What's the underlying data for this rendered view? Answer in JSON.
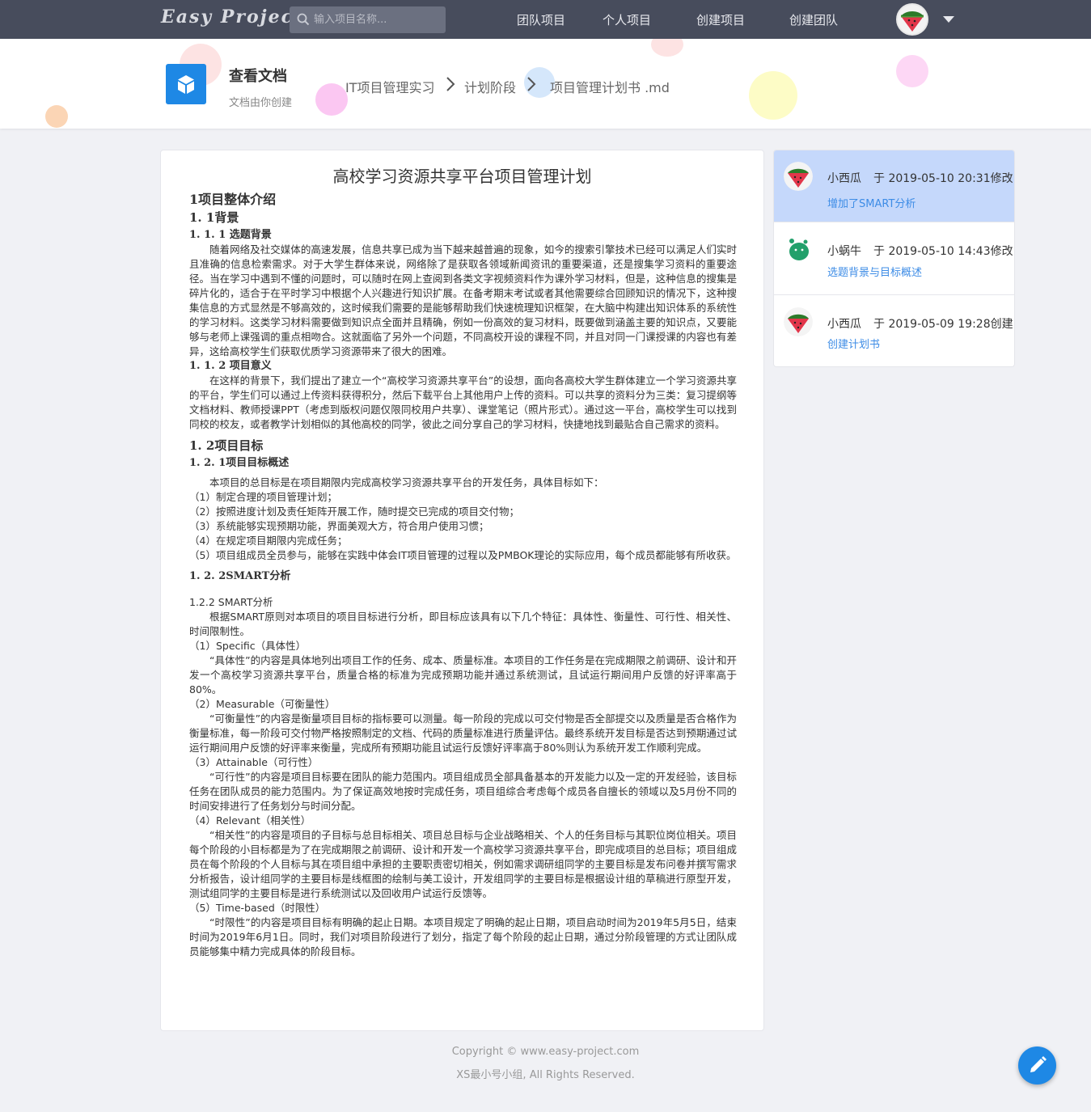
{
  "nav": {
    "logo": "Easy Project",
    "search_placeholder": "输入项目名称...",
    "links": [
      "团队项目",
      "个人项目",
      "创建项目",
      "创建团队"
    ]
  },
  "header": {
    "title": "查看文档",
    "subtitle": "文档由你创建",
    "breadcrumb": [
      "IT项目管理实习",
      "计划阶段",
      "项目管理计划书 .md"
    ]
  },
  "document": {
    "title": "高校学习资源共享平台项目管理计划",
    "h_1": "1项目整体介绍",
    "h_1_1": "1. 1背景",
    "h_1_1_1": "1. 1. 1  选题背景",
    "p_background": "随着网络及社交媒体的高速发展，信息共享已成为当下越来越普遍的现象，如今的搜索引擎技术已经可以满足人们实时且准确的信息检索需求。对于大学生群体来说，网络除了是获取各领域新闻资讯的重要渠道，还是搜集学习资料的重要途径。当在学习中遇到不懂的问题时，可以随时在网上查阅到各类文字视频资料作为课外学习材料，但是，这种信息的搜集是碎片化的，适合于在平时学习中根据个人兴趣进行知识扩展。在备考期末考试或者其他需要综合回顾知识的情况下，这种搜集信息的方式显然是不够高效的，这时候我们需要的是能够帮助我们快速梳理知识框架，在大脑中构建出知识体系的系统性的学习材料。这类学习材料需要做到知识点全面并且精确，例如一份高效的复习材料，既要做到涵盖主要的知识点，又要能够与老师上课强调的重点相吻合。这就面临了另外一个问题，不同高校开设的课程不同，并且对同一门课授课的内容也有差异，这给高校学生们获取优质学习资源带来了很大的困难。",
    "h_1_1_2": "1. 1. 2  项目意义",
    "p_meaning": "在这样的背景下，我们提出了建立一个“高校学习资源共享平台”的设想，面向各高校大学生群体建立一个学习资源共享的平台，学生们可以通过上传资料获得积分，然后下载平台上其他用户上传的资料。可以共享的资料分为三类：复习提纲等文档材料、教师授课PPT（考虑到版权问题仅限同校用户共享）、课堂笔记（照片形式）。通过这一平台，高校学生可以找到同校的校友，或者教学计划相似的其他高校的同学，彼此之间分享自己的学习材料，快捷地找到最贴合自己需求的资料。",
    "h_1_2": "1. 2项目目标",
    "h_1_2_1": "1. 2. 1项目目标概述",
    "p_goal_intro": "本项目的总目标是在项目期限内完成高校学习资源共享平台的开发任务，具体目标如下：",
    "goals": [
      "（1）制定合理的项目管理计划；",
      "（2）按照进度计划及责任矩阵开展工作，随时提交已完成的项目交付物；",
      "（3）系统能够实现预期功能，界面美观大方，符合用户使用习惯；",
      "（4）在规定项目期限内完成任务；",
      "（5）项目组成员全员参与，能够在实践中体会IT项目管理的过程以及PMBOK理论的实际应用，每个成员都能够有所收获。"
    ],
    "h_1_2_2": "1. 2. 2SMART分析",
    "smart_sub": "1.2.2 SMART分析",
    "p_smart_intro": "根据SMART原则对本项目的项目目标进行分析，即目标应该具有以下几个特征：具体性、衡量性、可行性、相关性、时间限制性。",
    "s_label": "（1）Specific（具体性）",
    "s_text": "“具体性”的内容是具体地列出项目工作的任务、成本、质量标准。本项目的工作任务是在完成期限之前调研、设计和开发一个高校学习资源共享平台，质量合格的标准为完成预期功能并通过系统测试，且试运行期间用户反馈的好评率高于80%。",
    "m_label": "（2）Measurable（可衡量性）",
    "m_text": "“可衡量性”的内容是衡量项目目标的指标要可以测量。每一阶段的完成以可交付物是否全部提交以及质量是否合格作为衡量标准，每一阶段可交付物严格按照制定的文档、代码的质量标准进行质量评估。最终系统开发目标是否达到预期通过试运行期间用户反馈的好评率来衡量，完成所有预期功能且试运行反馈好评率高于80%则认为系统开发工作顺利完成。",
    "a_label": "（3）Attainable（可行性）",
    "a_text": "“可行性”的内容是项目目标要在团队的能力范围内。项目组成员全部具备基本的开发能力以及一定的开发经验，该目标任务在团队成员的能力范围内。为了保证高效地按时完成任务，项目组综合考虑每个成员各自擅长的领域以及5月份不同的时间安排进行了任务划分与时间分配。",
    "r_label": "（4）Relevant（相关性）",
    "r_text": "“相关性”的内容是项目的子目标与总目标相关、项目总目标与企业战略相关、个人的任务目标与其职位岗位相关。项目每个阶段的小目标都是为了在完成期限之前调研、设计和开发一个高校学习资源共享平台，即完成项目的总目标；项目组成员在每个阶段的个人目标与其在项目组中承担的主要职责密切相关，例如需求调研组同学的主要目标是发布问卷并撰写需求分析报告，设计组同学的主要目标是线框图的绘制与美工设计，开发组同学的主要目标是根据设计组的草稿进行原型开发，测试组同学的主要目标是进行系统测试以及回收用户试运行反馈等。",
    "t_label": "（5）Time-based（时限性）",
    "t_text": "“时限性”的内容是项目目标有明确的起止日期。本项目规定了明确的起止日期，项目启动时间为2019年5月5日，结束时间为2019年6月1日。同时，我们对项目阶段进行了划分，指定了每个阶段的起止日期，通过分阶段管理的方式让团队成员能够集中精力完成具体的阶段目标。"
  },
  "history": [
    {
      "name": "小西瓜",
      "time": "于 2019-05-10 20:31修改",
      "message": "增加了SMART分析",
      "avatar": "watermelon-avatar",
      "active": true
    },
    {
      "name": "小蜗牛",
      "time": "于 2019-05-10 14:43修改",
      "message": "选题背景与目标概述",
      "avatar": "green-blob-avatar",
      "active": false
    },
    {
      "name": "小西瓜",
      "time": "于 2019-05-09 19:28创建",
      "message": "创建计划书",
      "avatar": "watermelon-avatar",
      "active": false
    }
  ],
  "footer": {
    "line1": "Copyright © www.easy-project.com",
    "line2": "XS最小号小组, All Rights Reserved."
  },
  "colors": {
    "nav_bg": "#474c5c",
    "accent": "#1e88e5",
    "active_history": "#c5d8fb",
    "link": "#3d8ce6"
  }
}
